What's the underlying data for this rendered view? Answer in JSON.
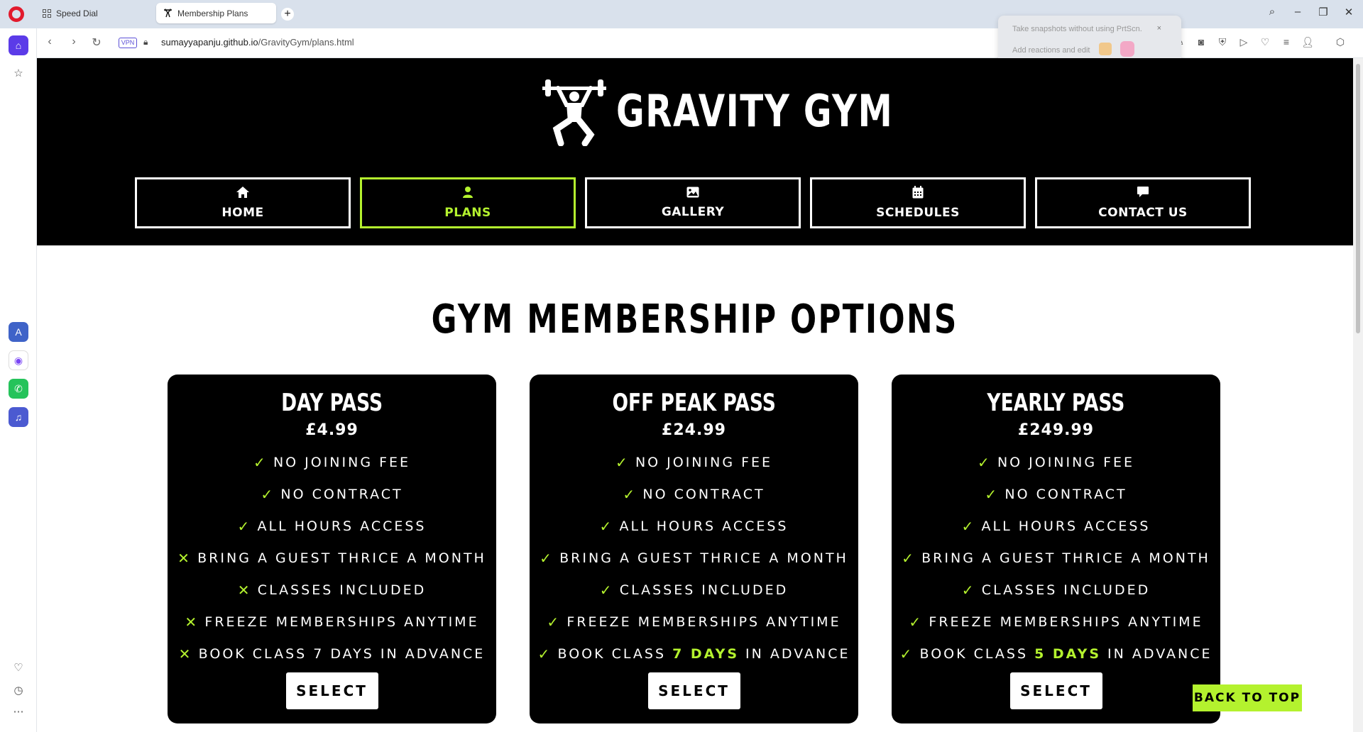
{
  "browser": {
    "tabs": [
      {
        "label": "Speed Dial",
        "icon": "speed-dial-icon"
      },
      {
        "label": "Membership Plans",
        "icon": "gym-favicon"
      }
    ],
    "new_tab": "+",
    "url_host": "sumayyapanju.github.io",
    "url_path": "/GravityGym/plans.html",
    "vpn_label": "VPN",
    "snapshot_popup": {
      "line1": "Take snapshots without using PrtScn.",
      "line2": "Add reactions and edit",
      "close": "×"
    }
  },
  "site": {
    "brand": "GRAVITY GYM",
    "nav": [
      {
        "label": "HOME",
        "icon": "home-icon",
        "active": false
      },
      {
        "label": "PLANS",
        "icon": "user-icon",
        "active": true
      },
      {
        "label": "GALLERY",
        "icon": "image-icon",
        "active": false
      },
      {
        "label": "SCHEDULES",
        "icon": "calendar-icon",
        "active": false
      },
      {
        "label": "CONTACT US",
        "icon": "comment-icon",
        "active": false
      }
    ],
    "accent": "#b4f22e",
    "page_title": "GYM MEMBERSHIP OPTIONS",
    "plans": [
      {
        "name": "DAY PASS",
        "price": "£4.99",
        "features": [
          {
            "text": "NO JOINING FEE",
            "included": true
          },
          {
            "text": "NO CONTRACT",
            "included": true
          },
          {
            "text": "ALL HOURS ACCESS",
            "included": true
          },
          {
            "text": "BRING A GUEST THRICE A MONTH",
            "included": false
          },
          {
            "text": "CLASSES INCLUDED",
            "included": false
          },
          {
            "text": "FREEZE MEMBERSHIPS ANYTIME",
            "included": false
          },
          {
            "pre": "BOOK CLASS ",
            "hl": "7 DAYS",
            "post": " IN ADVANCE",
            "included": false,
            "highlight": false
          }
        ],
        "button": "SELECT"
      },
      {
        "name": "OFF PEAK PASS",
        "price": "£24.99",
        "features": [
          {
            "text": "NO JOINING FEE",
            "included": true
          },
          {
            "text": "NO CONTRACT",
            "included": true
          },
          {
            "text": "ALL HOURS ACCESS",
            "included": true
          },
          {
            "text": "BRING A GUEST THRICE A MONTH",
            "included": true
          },
          {
            "text": "CLASSES INCLUDED",
            "included": true
          },
          {
            "text": "FREEZE MEMBERSHIPS ANYTIME",
            "included": true
          },
          {
            "pre": "BOOK CLASS ",
            "hl": "7 DAYS",
            "post": " IN ADVANCE",
            "included": true,
            "highlight": true
          }
        ],
        "button": "SELECT"
      },
      {
        "name": "YEARLY PASS",
        "price": "£249.99",
        "features": [
          {
            "text": "NO JOINING FEE",
            "included": true
          },
          {
            "text": "NO CONTRACT",
            "included": true
          },
          {
            "text": "ALL HOURS ACCESS",
            "included": true
          },
          {
            "text": "BRING A GUEST THRICE A MONTH",
            "included": true
          },
          {
            "text": "CLASSES INCLUDED",
            "included": true
          },
          {
            "text": "FREEZE MEMBERSHIPS ANYTIME",
            "included": true
          },
          {
            "pre": "BOOK CLASS ",
            "hl": "5 DAYS",
            "post": " IN ADVANCE",
            "included": true,
            "highlight": true
          }
        ],
        "button": "SELECT"
      }
    ],
    "back_to_top": "BACK TO TOP"
  }
}
